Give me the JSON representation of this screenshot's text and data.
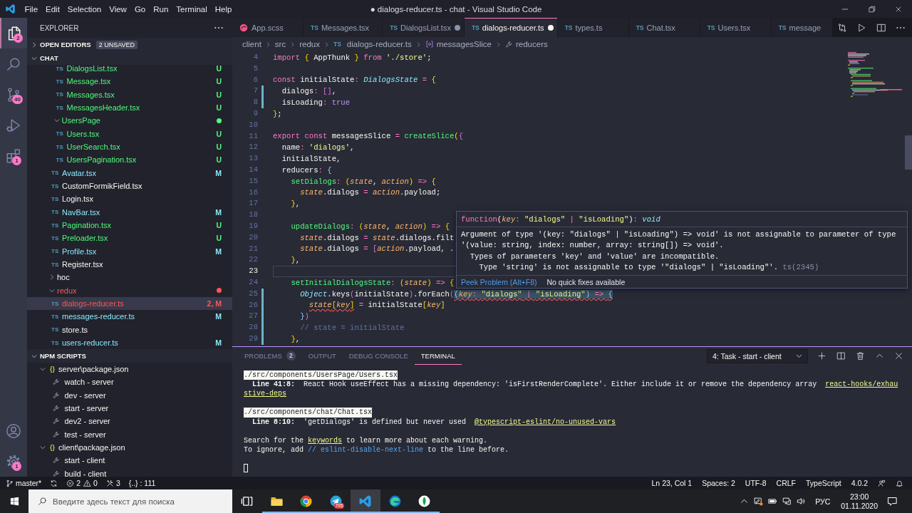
{
  "window": {
    "title": "● dialogs-reducer.ts - chat - Visual Studio Code",
    "menu": [
      "File",
      "Edit",
      "Selection",
      "View",
      "Go",
      "Run",
      "Terminal",
      "Help"
    ]
  },
  "activity_bar": {
    "top": [
      {
        "kind": "explorer",
        "badge": "2",
        "selected": true
      },
      {
        "kind": "search",
        "selected": false
      },
      {
        "kind": "source-control",
        "badge": "40",
        "selected": false
      },
      {
        "kind": "run",
        "selected": false
      },
      {
        "kind": "extensions",
        "badge": "1",
        "selected": false
      }
    ],
    "bottom": [
      {
        "kind": "accounts",
        "selected": false
      },
      {
        "kind": "settings",
        "badge": "1",
        "selected": false
      }
    ]
  },
  "sidebar": {
    "title": "EXPLORER",
    "sections": [
      {
        "kind": "open-editors",
        "label": "OPEN EDITORS",
        "expanded": false,
        "badge": "2 UNSAVED"
      },
      {
        "kind": "folder",
        "label": "CHAT",
        "expanded": true,
        "tree": [
          {
            "kind": "group",
            "children": [
              {
                "kind": "group",
                "children": [
                  {
                    "kind": "file",
                    "type_label": "TS",
                    "label": "DialogsList.tsx",
                    "color": "#50fa7b",
                    "decoration": "U",
                    "selected": false
                  },
                  {
                    "kind": "file",
                    "type_label": "TS",
                    "label": "Message.tsx",
                    "color": "#50fa7b",
                    "decoration": "U",
                    "selected": false
                  },
                  {
                    "kind": "file",
                    "type_label": "TS",
                    "label": "Messages.tsx",
                    "color": "#50fa7b",
                    "decoration": "U",
                    "selected": false
                  },
                  {
                    "kind": "file",
                    "type_label": "TS",
                    "label": "MessagesHeader.tsx",
                    "color": "#50fa7b",
                    "decoration": "U",
                    "selected": false
                  }
                ]
              },
              {
                "kind": "folder",
                "label": "UsersPage",
                "color": "#50fa7b",
                "has_changes": true,
                "expanded": true,
                "selected": false,
                "children": [
                  {
                    "kind": "file",
                    "type_label": "TS",
                    "label": "Users.tsx",
                    "color": "#50fa7b",
                    "decoration": "U",
                    "selected": false
                  },
                  {
                    "kind": "file",
                    "type_label": "TS",
                    "label": "UserSearch.tsx",
                    "color": "#50fa7b",
                    "decoration": "U",
                    "selected": false
                  },
                  {
                    "kind": "file",
                    "type_label": "TS",
                    "label": "UsersPagination.tsx",
                    "color": "#50fa7b",
                    "decoration": "U",
                    "selected": false
                  }
                ]
              },
              {
                "kind": "file",
                "type_label": "TS",
                "label": "Avatar.tsx",
                "color": "#8be9fd",
                "decoration": "M",
                "selected": false
              },
              {
                "kind": "file",
                "type_label": "TS",
                "label": "CustomFormikField.tsx",
                "selected": false
              },
              {
                "kind": "file",
                "type_label": "TS",
                "label": "Login.tsx",
                "selected": false
              },
              {
                "kind": "file",
                "type_label": "TS",
                "label": "NavBar.tsx",
                "color": "#8be9fd",
                "decoration": "M",
                "selected": false
              },
              {
                "kind": "file",
                "type_label": "TS",
                "label": "Pagination.tsx",
                "color": "#50fa7b",
                "decoration": "U",
                "selected": false
              },
              {
                "kind": "file",
                "type_label": "TS",
                "label": "Preloader.tsx",
                "color": "#50fa7b",
                "decoration": "U",
                "selected": false
              },
              {
                "kind": "file",
                "type_label": "TS",
                "label": "Profile.tsx",
                "color": "#8be9fd",
                "decoration": "M",
                "selected": false
              },
              {
                "kind": "file",
                "type_label": "TS",
                "label": "Register.tsx",
                "selected": false
              }
            ]
          },
          {
            "kind": "folder",
            "label": "hoc",
            "has_changes": false,
            "expanded": false,
            "selected": false
          },
          {
            "kind": "folder",
            "label": "redux",
            "color": "#ff5555",
            "has_changes": true,
            "expanded": true,
            "selected": false,
            "children": [
              {
                "kind": "file",
                "type_label": "TS",
                "label": "dialogs-reducer.ts",
                "color": "#ff5555",
                "decoration": "2, M",
                "selected": true
              },
              {
                "kind": "file",
                "type_label": "TS",
                "label": "messages-reducer.ts",
                "color": "#8be9fd",
                "decoration": "M",
                "selected": false
              },
              {
                "kind": "file",
                "type_label": "TS",
                "label": "store.ts",
                "selected": false
              },
              {
                "kind": "file",
                "type_label": "TS",
                "label": "users-reducer.ts",
                "color": "#8be9fd",
                "decoration": "M",
                "selected": false
              }
            ]
          }
        ]
      },
      {
        "kind": "npm-scripts",
        "label": "NPM SCRIPTS",
        "expanded": true,
        "tree": [
          {
            "kind": "package",
            "type_label": "{}",
            "label": "server\\package.json",
            "expanded": true,
            "selected": false,
            "children": [
              {
                "kind": "script",
                "label": "watch - server",
                "selected": false
              },
              {
                "kind": "script",
                "label": "dev - server",
                "selected": false
              },
              {
                "kind": "script",
                "label": "start - server",
                "selected": false
              },
              {
                "kind": "script",
                "label": "dev2 - server",
                "selected": false
              },
              {
                "kind": "script",
                "label": "test - server",
                "selected": false
              }
            ]
          },
          {
            "kind": "package",
            "type_label": "{}",
            "label": "client\\package.json",
            "expanded": true,
            "selected": false,
            "children": [
              {
                "kind": "script",
                "label": "start - client",
                "selected": false
              },
              {
                "kind": "script",
                "label": "build - client",
                "selected": false
              }
            ]
          }
        ]
      }
    ]
  },
  "editor": {
    "tabs": [
      {
        "kind": "sass",
        "label": "App.scss",
        "dirty": false,
        "selected": false
      },
      {
        "kind": "typescript",
        "type_label": "TS",
        "label": "Messages.tsx",
        "dirty": false,
        "selected": false
      },
      {
        "kind": "typescript",
        "type_label": "TS",
        "label": "DialogsList.tsx",
        "dirty": true,
        "selected": false
      },
      {
        "kind": "typescript",
        "type_label": "TS",
        "label": "dialogs-reducer.ts",
        "dirty": true,
        "selected": true
      },
      {
        "kind": "typescript",
        "type_label": "TS",
        "label": "types.ts",
        "dirty": false,
        "selected": false
      },
      {
        "kind": "typescript",
        "type_label": "TS",
        "label": "Chat.tsx",
        "dirty": false,
        "selected": false
      },
      {
        "kind": "typescript",
        "type_label": "TS",
        "label": "Users.tsx",
        "dirty": false,
        "selected": false
      },
      {
        "kind": "typescript",
        "type_label": "TS",
        "label": "message",
        "dirty": false,
        "selected": false
      }
    ],
    "breadcrumbs": [
      {
        "kind": "folder",
        "label": "client"
      },
      {
        "kind": "folder",
        "label": "src"
      },
      {
        "kind": "folder",
        "label": "redux"
      },
      {
        "kind": "file",
        "type_label": "TS",
        "label": "dialogs-reducer.ts"
      },
      {
        "kind": "symbol",
        "label": "messagesSlice"
      },
      {
        "kind": "property",
        "label": "reducers"
      }
    ],
    "lines": [
      {
        "number": "4",
        "changed": false,
        "cursor_line": false,
        "tokens": [
          {
            "text": "import ",
            "kind": "keyword"
          },
          {
            "text": "{",
            "kind": "bracket-1"
          },
          {
            "text": " AppThunk ",
            "kind": "text"
          },
          {
            "text": "}",
            "kind": "bracket-1"
          },
          {
            "text": " from ",
            "kind": "keyword"
          },
          {
            "text": "'./store'",
            "kind": "string"
          },
          {
            "text": ";",
            "kind": "text"
          }
        ]
      },
      {
        "number": "5",
        "changed": false,
        "cursor_line": false
      },
      {
        "number": "6",
        "changed": false,
        "cursor_line": false,
        "tokens": [
          {
            "text": "const ",
            "kind": "keyword"
          },
          {
            "text": "initialState",
            "kind": "text"
          },
          {
            "text": ": ",
            "kind": "operator"
          },
          {
            "text": "DialogsState",
            "kind": "type"
          },
          {
            "text": " = ",
            "kind": "operator"
          },
          {
            "text": "{",
            "kind": "bracket-1"
          }
        ],
        "children": [
          {
            "number": "7",
            "changed": true,
            "cursor_line": false,
            "tokens": [
              {
                "text": "dialogs",
                "kind": "text"
              },
              {
                "text": ": ",
                "kind": "operator"
              },
              {
                "text": "[]",
                "kind": "bracket-2"
              },
              {
                "text": ",",
                "kind": "text"
              }
            ]
          },
          {
            "number": "8",
            "changed": true,
            "cursor_line": false,
            "tokens": [
              {
                "text": "isLoading",
                "kind": "text"
              },
              {
                "text": ": ",
                "kind": "operator"
              },
              {
                "text": "true",
                "kind": "constant"
              }
            ]
          }
        ]
      },
      {
        "number": "9",
        "changed": false,
        "cursor_line": false,
        "tokens": [
          {
            "text": "}",
            "kind": "bracket-1"
          },
          {
            "text": ";",
            "kind": "text"
          }
        ]
      },
      {
        "number": "10",
        "changed": false,
        "cursor_line": false
      },
      {
        "number": "11",
        "changed": false,
        "cursor_line": false,
        "tokens": [
          {
            "text": "export const ",
            "kind": "keyword"
          },
          {
            "text": "messagesSlice",
            "kind": "text"
          },
          {
            "text": " = ",
            "kind": "operator"
          },
          {
            "text": "createSlice",
            "kind": "function"
          },
          {
            "text": "(",
            "kind": "bracket-1"
          },
          {
            "text": "{",
            "kind": "bracket-2"
          }
        ],
        "children": [
          {
            "number": "12",
            "changed": false,
            "cursor_line": false,
            "tokens": [
              {
                "text": "name",
                "kind": "text"
              },
              {
                "text": ": ",
                "kind": "operator"
              },
              {
                "text": "'dialogs'",
                "kind": "string"
              },
              {
                "text": ",",
                "kind": "text"
              }
            ]
          },
          {
            "number": "13",
            "changed": false,
            "cursor_line": false,
            "tokens": [
              {
                "text": "initialState,",
                "kind": "text"
              }
            ]
          },
          {
            "number": "14",
            "changed": false,
            "cursor_line": false,
            "tokens": [
              {
                "text": "reducers",
                "kind": "text"
              },
              {
                "text": ": ",
                "kind": "operator"
              },
              {
                "text": "{",
                "kind": "bracket-3"
              }
            ],
            "children": [
              {
                "number": "15",
                "changed": false,
                "cursor_line": false,
                "tokens": [
                  {
                    "text": "setDialogs",
                    "kind": "function"
                  },
                  {
                    "text": ": ",
                    "kind": "operator"
                  },
                  {
                    "text": "(",
                    "kind": "bracket-1"
                  },
                  {
                    "text": "state",
                    "kind": "parameter"
                  },
                  {
                    "text": ", ",
                    "kind": "text"
                  },
                  {
                    "text": "action",
                    "kind": "parameter"
                  },
                  {
                    "text": ")",
                    "kind": "bracket-1"
                  },
                  {
                    "text": " => ",
                    "kind": "operator"
                  },
                  {
                    "text": "{",
                    "kind": "bracket-1"
                  }
                ],
                "children": [
                  {
                    "number": "16",
                    "changed": false,
                    "cursor_line": false,
                    "tokens": [
                      {
                        "text": "state",
                        "kind": "parameter"
                      },
                      {
                        "text": ".dialogs",
                        "kind": "text"
                      },
                      {
                        "text": " = ",
                        "kind": "operator"
                      },
                      {
                        "text": "action",
                        "kind": "parameter"
                      },
                      {
                        "text": ".payload;",
                        "kind": "text"
                      }
                    ]
                  }
                ]
              },
              {
                "number": "17",
                "changed": false,
                "cursor_line": false,
                "tokens": [
                  {
                    "text": "}",
                    "kind": "bracket-1"
                  },
                  {
                    "text": ",",
                    "kind": "text"
                  }
                ]
              },
              {
                "number": "18",
                "changed": false,
                "cursor_line": false
              },
              {
                "number": "19",
                "changed": false,
                "cursor_line": false,
                "tokens": [
                  {
                    "text": "updateDialogs",
                    "kind": "function"
                  },
                  {
                    "text": ": ",
                    "kind": "operator"
                  },
                  {
                    "text": "(",
                    "kind": "bracket-1"
                  },
                  {
                    "text": "state",
                    "kind": "parameter"
                  },
                  {
                    "text": ", ",
                    "kind": "text"
                  },
                  {
                    "text": "action",
                    "kind": "parameter"
                  },
                  {
                    "text": ")",
                    "kind": "bracket-1"
                  },
                  {
                    "text": " => ",
                    "kind": "operator"
                  },
                  {
                    "text": "{",
                    "kind": "bracket-1"
                  }
                ],
                "children": [
                  {
                    "number": "20",
                    "changed": false,
                    "cursor_line": false,
                    "tokens": [
                      {
                        "text": "state",
                        "kind": "parameter"
                      },
                      {
                        "text": ".dialogs",
                        "kind": "text"
                      },
                      {
                        "text": " = ",
                        "kind": "operator"
                      },
                      {
                        "text": "state",
                        "kind": "parameter"
                      },
                      {
                        "text": ".dialogs.filt",
                        "kind": "text"
                      }
                    ]
                  },
                  {
                    "number": "21",
                    "changed": false,
                    "cursor_line": false,
                    "tokens": [
                      {
                        "text": "state",
                        "kind": "parameter"
                      },
                      {
                        "text": ".dialogs",
                        "kind": "text"
                      },
                      {
                        "text": " = ",
                        "kind": "operator"
                      },
                      {
                        "text": "[",
                        "kind": "bracket-2"
                      },
                      {
                        "text": "action",
                        "kind": "parameter"
                      },
                      {
                        "text": ".payload, .",
                        "kind": "text"
                      }
                    ]
                  }
                ]
              },
              {
                "number": "22",
                "changed": false,
                "cursor_line": false,
                "tokens": [
                  {
                    "text": "}",
                    "kind": "bracket-1"
                  },
                  {
                    "text": ",",
                    "kind": "text"
                  }
                ]
              },
              {
                "number": "23",
                "changed": false,
                "cursor_line": true
              },
              {
                "number": "24",
                "changed": false,
                "cursor_line": false,
                "tokens": [
                  {
                    "text": "setInitialDialogsState",
                    "kind": "function"
                  },
                  {
                    "text": ": ",
                    "kind": "operator"
                  },
                  {
                    "text": "(",
                    "kind": "bracket-1"
                  },
                  {
                    "text": "state",
                    "kind": "parameter"
                  },
                  {
                    "text": ")",
                    "kind": "bracket-1"
                  },
                  {
                    "text": " => ",
                    "kind": "operator"
                  },
                  {
                    "text": "{",
                    "kind": "bracket-1"
                  }
                ],
                "children": [
                  {
                    "number": "25",
                    "changed": true,
                    "cursor_line": false,
                    "tokens": [
                      {
                        "text": "Object",
                        "kind": "type"
                      },
                      {
                        "text": ".keys",
                        "kind": "text"
                      },
                      {
                        "text": "(",
                        "kind": "bracket-2"
                      },
                      {
                        "text": "initialState",
                        "kind": "text"
                      },
                      {
                        "text": ")",
                        "kind": "bracket-2"
                      },
                      {
                        "text": ".forEach",
                        "kind": "text"
                      },
                      {
                        "text": "(",
                        "kind": "bracket-2"
                      },
                      {
                        "kind": "diagnostic",
                        "hovered": true,
                        "tokens": [
                          {
                            "text": "(",
                            "kind": "bracket-3"
                          },
                          {
                            "text": "key",
                            "kind": "parameter"
                          },
                          {
                            "text": ": ",
                            "kind": "operator"
                          },
                          {
                            "text": "\"dialogs\"",
                            "kind": "string"
                          },
                          {
                            "text": " | ",
                            "kind": "operator"
                          },
                          {
                            "text": "\"isLoading\"",
                            "kind": "string"
                          },
                          {
                            "text": ")",
                            "kind": "bracket-3"
                          },
                          {
                            "text": " => ",
                            "kind": "operator"
                          },
                          {
                            "text": "{",
                            "kind": "bracket-3"
                          }
                        ]
                      }
                    ],
                    "children": [
                      {
                        "number": "26",
                        "changed": true,
                        "cursor_line": false,
                        "tokens": [
                          {
                            "kind": "diagnostic",
                            "hovered": false,
                            "tokens": [
                              {
                                "text": "state",
                                "kind": "parameter"
                              },
                              {
                                "text": "[",
                                "kind": "bracket-1"
                              },
                              {
                                "text": "key",
                                "kind": "parameter"
                              },
                              {
                                "text": "]",
                                "kind": "bracket-1"
                              }
                            ]
                          },
                          {
                            "text": " = ",
                            "kind": "operator"
                          },
                          {
                            "text": "initialState",
                            "kind": "text"
                          },
                          {
                            "text": "[",
                            "kind": "bracket-1"
                          },
                          {
                            "text": "key",
                            "kind": "parameter"
                          },
                          {
                            "text": "]",
                            "kind": "bracket-1"
                          }
                        ]
                      }
                    ]
                  },
                  {
                    "number": "27",
                    "changed": true,
                    "cursor_line": false,
                    "tokens": [
                      {
                        "text": "}",
                        "kind": "bracket-3"
                      },
                      {
                        "text": ")",
                        "kind": "bracket-2"
                      }
                    ]
                  },
                  {
                    "number": "28",
                    "changed": true,
                    "cursor_line": false,
                    "tokens": [
                      {
                        "text": "// state = initialState",
                        "kind": "comment"
                      }
                    ]
                  }
                ]
              },
              {
                "number": "29",
                "changed": true,
                "cursor_line": false,
                "tokens": [
                  {
                    "text": "}",
                    "kind": "bracket-1"
                  },
                  {
                    "text": ",",
                    "kind": "text"
                  }
                ]
              }
            ]
          }
        ]
      }
    ],
    "hover": {
      "signature": [
        {
          "text": "function",
          "kind": "keyword"
        },
        {
          "text": "(",
          "kind": "text"
        },
        {
          "text": "key",
          "kind": "parameter"
        },
        {
          "text": ": ",
          "kind": "operator"
        },
        {
          "text": "\"dialogs\"",
          "kind": "string"
        },
        {
          "text": " | ",
          "kind": "operator"
        },
        {
          "text": "\"isLoading\"",
          "kind": "string"
        },
        {
          "text": ")",
          "kind": "text"
        },
        {
          "text": ": ",
          "kind": "operator"
        },
        {
          "text": "void",
          "kind": "type"
        }
      ],
      "messages": [
        {
          "text": "Argument of type '(key: \"dialogs\" | \"isLoading\") => void' is not assignable to parameter of type '(value: string, index: number, array: string[]) => void'.",
          "children": [
            {
              "text": "Types of parameters 'key' and 'value' are incompatible.",
              "children": [
                {
                  "text": "Type 'string' is not assignable to type '\"dialogs\" | \"isLoading\"'.",
                  "code": "ts(2345)"
                }
              ]
            }
          ]
        }
      ],
      "actions": [
        {
          "kind": "link",
          "label": "Peek Problem (Alt+F8)"
        },
        {
          "kind": "note",
          "label": "No quick fixes available"
        }
      ]
    }
  },
  "panel": {
    "tabs": [
      {
        "label": "PROBLEMS",
        "badge": "2",
        "selected": false
      },
      {
        "label": "OUTPUT",
        "selected": false
      },
      {
        "label": "DEBUG CONSOLE",
        "selected": false
      },
      {
        "label": "TERMINAL",
        "selected": true
      }
    ],
    "terminal_select": "4: Task - start - client",
    "terminal": {
      "cursor": true,
      "blocks": [
        [
          {
            "spans": [
              {
                "kind": "file-path",
                "text": "./src/components/UsersPage/Users.tsx"
              }
            ],
            "children": [
              {
                "spans": [
                  {
                    "kind": "location",
                    "text": "Line 41:8:"
                  },
                  {
                    "kind": "message",
                    "text": "  React Hook useEffect has a missing dependency: 'isFirstRenderComplete'. Either include it or remove the dependency array  "
                  },
                  {
                    "kind": "rule-link",
                    "text": "react-hooks/exhau"
                  }
                ]
              }
            ]
          },
          {
            "spans": [
              {
                "kind": "rule-link",
                "text": "stive-deps"
              }
            ]
          }
        ],
        [
          {
            "spans": [
              {
                "kind": "file-path",
                "text": "./src/components/chat/Chat.tsx"
              }
            ],
            "children": [
              {
                "spans": [
                  {
                    "kind": "location",
                    "text": "Line 8:10:"
                  },
                  {
                    "kind": "message",
                    "text": "  'getDialogs' is defined but never used  "
                  },
                  {
                    "kind": "rule-link",
                    "text": "@typescript-eslint/no-unused-vars"
                  }
                ]
              }
            ]
          }
        ],
        [
          {
            "spans": [
              {
                "kind": "message",
                "text": "Search for the "
              },
              {
                "kind": "link",
                "text": "keywords"
              },
              {
                "kind": "message",
                "text": " to learn more about each warning."
              }
            ]
          },
          {
            "spans": [
              {
                "kind": "message",
                "text": "To ignore, add "
              },
              {
                "kind": "code",
                "text": "// eslint-disable-next-line"
              },
              {
                "kind": "message",
                "text": " to the line before."
              }
            ]
          }
        ]
      ]
    }
  },
  "status_bar": {
    "left": [
      {
        "kind": "branch",
        "label": "master*"
      },
      {
        "kind": "sync"
      },
      {
        "kind": "errors",
        "label": "2"
      },
      {
        "kind": "warnings",
        "label": "0"
      },
      {
        "kind": "tools",
        "label": "3"
      },
      {
        "kind": "text",
        "label": "{..} : 111"
      }
    ],
    "right": [
      {
        "kind": "text",
        "label": "Ln 23, Col 1"
      },
      {
        "kind": "text",
        "label": "Spaces: 2"
      },
      {
        "kind": "text",
        "label": "UTF-8"
      },
      {
        "kind": "text",
        "label": "CRLF"
      },
      {
        "kind": "text",
        "label": "TypeScript"
      },
      {
        "kind": "text",
        "label": "4.0.2"
      },
      {
        "kind": "feedback"
      },
      {
        "kind": "notifications"
      }
    ]
  },
  "taskbar": {
    "search": {
      "placeholder": "Введите здесь текст для поиска"
    },
    "apps": [
      {
        "kind": "task-view",
        "running": false,
        "selected": false
      },
      {
        "kind": "file-explorer",
        "running": true,
        "selected": false
      },
      {
        "kind": "chrome",
        "running": true,
        "selected": false
      },
      {
        "kind": "telegram",
        "badge": "795",
        "running": true,
        "selected": false
      },
      {
        "kind": "vscode",
        "running": true,
        "selected": true
      },
      {
        "kind": "edge",
        "running": true,
        "selected": false
      },
      {
        "kind": "leaf",
        "running": true,
        "selected": false
      }
    ],
    "tray": {
      "language": "РУС",
      "time": "23:00",
      "date": "01.11.2020"
    }
  }
}
